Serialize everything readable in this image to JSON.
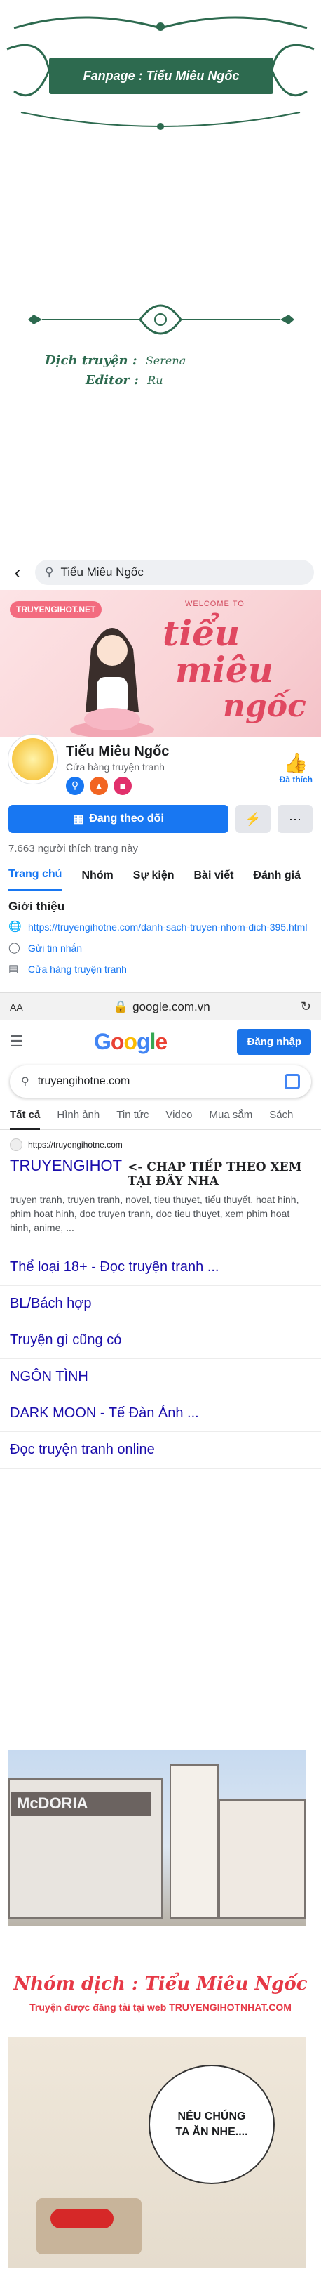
{
  "header": {
    "fanpage": "Fanpage : Tiểu Miêu Ngốc",
    "translator_label": "Dịch truyện :",
    "translator_sig": "Serena",
    "editor_label": "Editor :",
    "editor_sig": "Ru"
  },
  "facebook": {
    "search_query": "Tiểu Miêu Ngốc",
    "cover": {
      "logo": "TRUYENGIHOT.NET",
      "welcome": "WELCOME TO",
      "title_line1": "tiểu",
      "title_line2": "miêu",
      "title_line3": "ngốc"
    },
    "page_name": "Tiểu Miêu Ngốc",
    "page_category": "Cửa hàng truyện tranh",
    "liked_label": "Đã thích",
    "follow_button": "Đang theo dõi",
    "more_button": "···",
    "likes_count": "7.663 người thích trang này",
    "tabs": [
      "Trang chủ",
      "Nhóm",
      "Sự kiện",
      "Bài viết",
      "Đánh giá"
    ],
    "intro": {
      "heading": "Giới thiệu",
      "link": "https://truyengihotne.com/danh-sach-truyen-nhom-dich-395.html",
      "message": "Gửi tin nhắn",
      "category": "Cửa hàng truyện tranh"
    }
  },
  "google": {
    "aa": "AA",
    "url": "google.com.vn",
    "logo": [
      "G",
      "o",
      "o",
      "g",
      "l",
      "e"
    ],
    "login": "Đăng nhập",
    "query": "truyengihotne.com",
    "tabs": [
      "Tất cả",
      "Hình ảnh",
      "Tin tức",
      "Video",
      "Mua sắm",
      "Sách"
    ],
    "result": {
      "site": "https://truyengihotne.com",
      "title": "TRUYENGIHOT",
      "cta": "<- CHAP TIẾP THEO XEM TẠI ĐÂY NHA",
      "snippet": "truyen tranh, truyen tranh, novel, tieu thuyet, tiểu thuyết, hoat hinh, phim hoat hinh, doc truyen tranh, doc tieu thuyet, xem phim hoat hinh, anime, ..."
    },
    "links": [
      "Thể loại 18+ - Đọc truyện tranh ...",
      "BL/Bách hợp",
      "Truyện gì cũng có",
      "NGÔN TÌNH",
      "DARK MOON - Tế Đàn Ánh ...",
      "Đọc truyện tranh online"
    ]
  },
  "manga": {
    "sign": "McDORIA",
    "group_title": "Nhóm dịch : Tiểu Miêu Ngốc",
    "group_sub": "Truyện được đăng tải tại web TRUYENGIHOTNHAT.COM",
    "bubble": "NẾU CHÚNG TA ĂN NHE...."
  }
}
